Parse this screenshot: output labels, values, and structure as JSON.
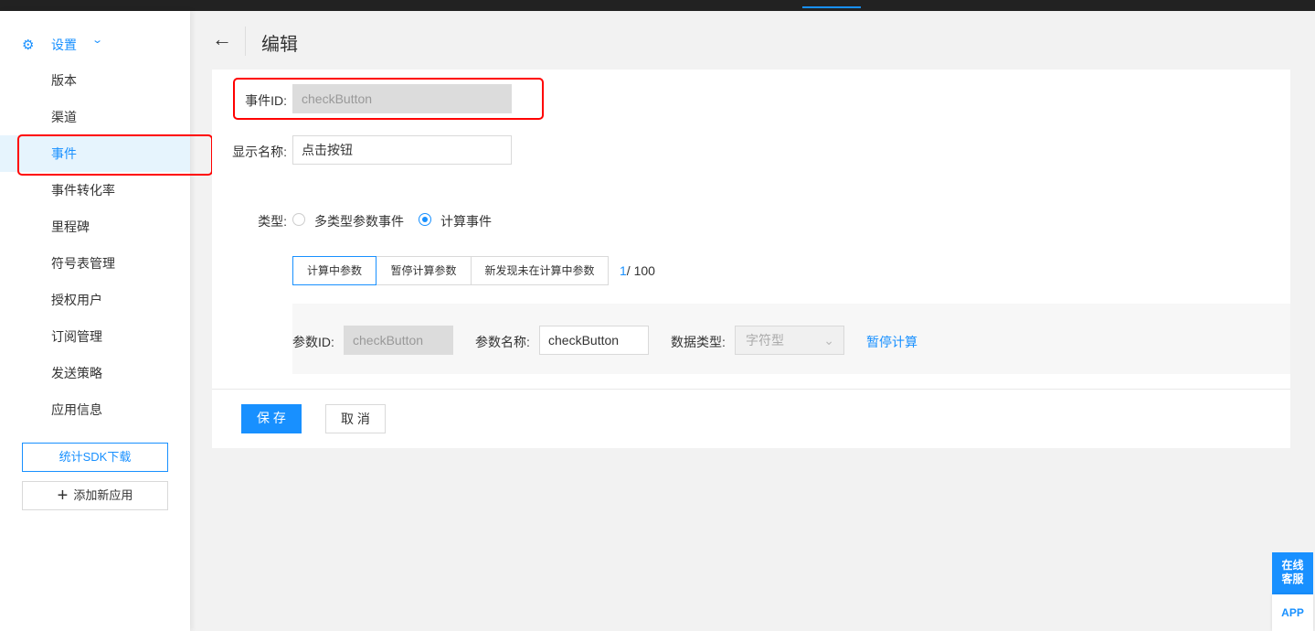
{
  "sidebar": {
    "section": "设置",
    "items": [
      "版本",
      "渠道",
      "事件",
      "事件转化率",
      "里程碑",
      "符号表管理",
      "授权用户",
      "订阅管理",
      "发送策略",
      "应用信息"
    ],
    "active": "事件",
    "sdk_button": "统计SDK下载",
    "add_app_button": "添加新应用"
  },
  "header": {
    "title": "编辑"
  },
  "form": {
    "event_id_label": "事件ID:",
    "event_id_value": "checkButton",
    "display_name_label": "显示名称:",
    "display_name_value": "点击按钮",
    "type_label": "类型:",
    "type_options": [
      "多类型参数事件",
      "计算事件"
    ],
    "type_selected": "计算事件",
    "tabs": [
      "计算中参数",
      "暂停计算参数",
      "新发现未在计算中参数"
    ],
    "count_current": "1",
    "count_total": "/ 100",
    "param": {
      "id_label": "参数ID:",
      "id_value": "checkButton",
      "name_label": "参数名称:",
      "name_value": "checkButton",
      "datatype_label": "数据类型:",
      "datatype_value": "字符型",
      "pause_link": "暂停计算"
    },
    "save": "保 存",
    "cancel": "取 消"
  },
  "float": {
    "service": "在线客服",
    "app": "APP"
  },
  "colors": {
    "accent": "#1890ff",
    "highlight": "#ff0000"
  }
}
